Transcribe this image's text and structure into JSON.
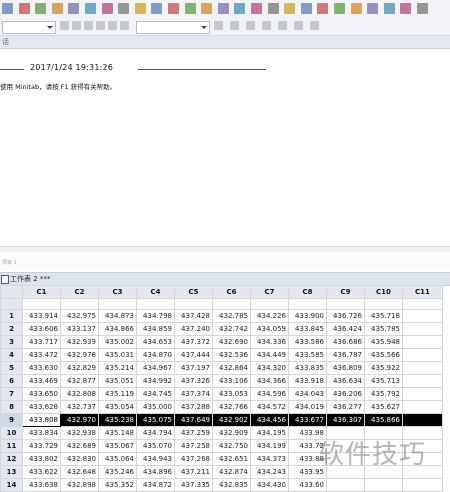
{
  "session": {
    "timestamp": "2017/1/24 19:31:26",
    "welcome": "使用 Minitab，请按 F1 获得有关帮助。"
  },
  "project_label": "项目 1",
  "worksheet": {
    "title": "工作表 2 ***",
    "columns": [
      "C1",
      "C2",
      "C3",
      "C4",
      "C5",
      "C6",
      "C7",
      "C8",
      "C9",
      "C10",
      "C11"
    ],
    "selected_row": 9,
    "rows": [
      {
        "n": "1",
        "v": [
          "433.914",
          "432.975",
          "434.873",
          "434.798",
          "437.428",
          "432.785",
          "434.226",
          "433.900",
          "436.726",
          "435.718",
          ""
        ]
      },
      {
        "n": "2",
        "v": [
          "433.606",
          "433.137",
          "434.866",
          "434.859",
          "437.240",
          "432.742",
          "434.059",
          "433.845",
          "436.424",
          "435.785",
          ""
        ]
      },
      {
        "n": "3",
        "v": [
          "433.717",
          "432.939",
          "435.002",
          "434.653",
          "437.372",
          "432.690",
          "434.336",
          "433.586",
          "436.686",
          "435.948",
          ""
        ]
      },
      {
        "n": "4",
        "v": [
          "433.472",
          "432.978",
          "435.031",
          "434.870",
          "437.444",
          "432.536",
          "434.449",
          "433.585",
          "436.787",
          "435.566",
          ""
        ]
      },
      {
        "n": "5",
        "v": [
          "433.630",
          "432.829",
          "435.214",
          "434.967",
          "437.197",
          "432.864",
          "434.320",
          "433.835",
          "436.809",
          "435.922",
          ""
        ]
      },
      {
        "n": "6",
        "v": [
          "433.469",
          "432.877",
          "435.051",
          "434.992",
          "437.326",
          "433.106",
          "434.366",
          "433.918",
          "436.634",
          "435.713",
          ""
        ]
      },
      {
        "n": "7",
        "v": [
          "433.650",
          "432.808",
          "435.119",
          "434.745",
          "437.374",
          "433.053",
          "434.596",
          "434.043",
          "436.206",
          "435.792",
          ""
        ]
      },
      {
        "n": "8",
        "v": [
          "433.628",
          "432.737",
          "435.054",
          "435.000",
          "437.288",
          "432.766",
          "434.572",
          "434.019",
          "436.277",
          "435.627",
          ""
        ]
      },
      {
        "n": "9",
        "v": [
          "433.808",
          "432.970",
          "435.238",
          "435.075",
          "437.649",
          "432.902",
          "434.456",
          "433.677",
          "436.307",
          "435.866",
          ""
        ]
      },
      {
        "n": "10",
        "v": [
          "433.834",
          "432.938",
          "435.148",
          "434.794",
          "437.259",
          "432.909",
          "434.195",
          "433.98",
          "",
          "",
          ""
        ]
      },
      {
        "n": "11",
        "v": [
          "433.729",
          "432.689",
          "435.067",
          "435.070",
          "437.258",
          "432.750",
          "434.199",
          "433.72",
          "",
          "",
          ""
        ]
      },
      {
        "n": "12",
        "v": [
          "433.802",
          "432.830",
          "435.064",
          "434.943",
          "437.268",
          "432.651",
          "434.373",
          "433.88",
          "",
          "",
          ""
        ]
      },
      {
        "n": "13",
        "v": [
          "433.622",
          "432.648",
          "435.246",
          "434.896",
          "437.211",
          "432.874",
          "434.243",
          "433.95",
          "",
          "",
          ""
        ]
      },
      {
        "n": "14",
        "v": [
          "433.638",
          "432.898",
          "435.352",
          "434.872",
          "437.335",
          "432.835",
          "434.430",
          "433.60",
          "",
          "",
          ""
        ]
      }
    ]
  },
  "watermark": "软件技巧",
  "toolbar": {
    "icons1": [
      "print-icon",
      "cut-icon",
      "copy-icon",
      "paste-icon",
      "undo-icon",
      "redo-icon",
      "window-icon",
      "up-icon",
      "down-icon",
      "find-icon",
      "stop-icon",
      "help-icon",
      "worksheet-icon",
      "session-icon",
      "info-icon",
      "graph-icon",
      "report-icon",
      "project-icon",
      "close-icon",
      "layout-icon",
      "brush-icon",
      "graph2-icon",
      "set-icon",
      "dist-icon",
      "line-icon",
      "lines-icon"
    ],
    "icons2": [
      "edit-icon",
      "pointer-icon",
      "pen-icon",
      "plus-icon",
      "arrow-icon",
      "clear-icon",
      "select-icon",
      "zoom-icon",
      "text-icon",
      "rect-icon",
      "ellipse-icon",
      "polygon-icon",
      "marker-icon"
    ]
  }
}
